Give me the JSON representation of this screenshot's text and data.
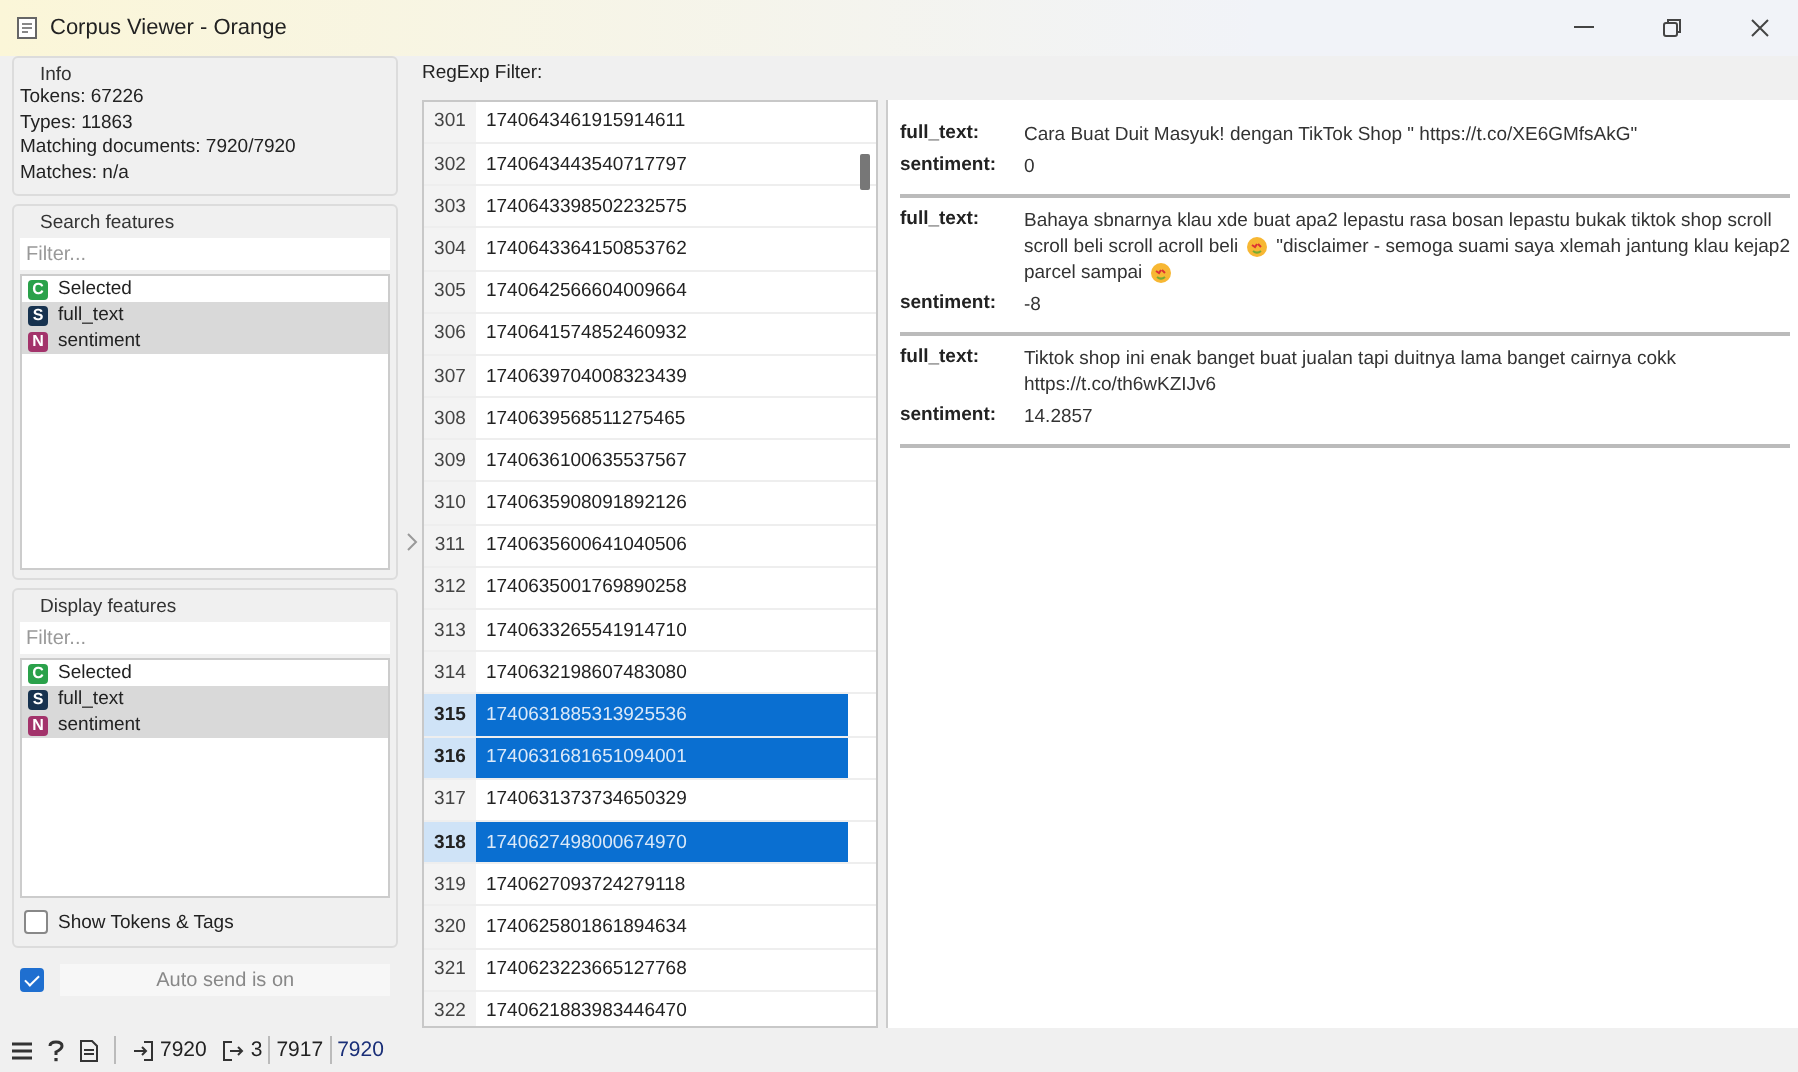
{
  "window": {
    "title": "Corpus Viewer - Orange"
  },
  "info": {
    "title": "Info",
    "lines": [
      "Tokens: 67226",
      "Types: 11863",
      "Matching documents: 7920/7920",
      "Matches: n/a"
    ]
  },
  "search_features": {
    "title": "Search features",
    "filter": {
      "placeholder": "Filter..."
    },
    "items": [
      {
        "badge": "C",
        "label": "Selected",
        "color": "#2aa14a",
        "selected": false
      },
      {
        "badge": "S",
        "label": "full_text",
        "color": "#17324f",
        "selected": true
      },
      {
        "badge": "N",
        "label": "sentiment",
        "color": "#a3336b",
        "selected": true
      }
    ]
  },
  "display_features": {
    "title": "Display features",
    "filter": {
      "placeholder": "Filter..."
    },
    "items": [
      {
        "badge": "C",
        "label": "Selected",
        "color": "#2aa14a",
        "selected": false
      },
      {
        "badge": "S",
        "label": "full_text",
        "color": "#17324f",
        "selected": true
      },
      {
        "badge": "N",
        "label": "sentiment",
        "color": "#a3336b",
        "selected": true
      }
    ]
  },
  "show_tokens": {
    "label": "Show Tokens & Tags",
    "checked": false
  },
  "auto_send": {
    "checked": true,
    "label": "Auto send is on"
  },
  "regexp_filter": {
    "label": "RegExp Filter:"
  },
  "documents": [
    {
      "index": "301",
      "id": "1740643461915914611",
      "selected": false
    },
    {
      "index": "302",
      "id": "1740643443540717797",
      "selected": false
    },
    {
      "index": "303",
      "id": "1740643398502232575",
      "selected": false
    },
    {
      "index": "304",
      "id": "1740643364150853762",
      "selected": false
    },
    {
      "index": "305",
      "id": "1740642566604009664",
      "selected": false
    },
    {
      "index": "306",
      "id": "1740641574852460932",
      "selected": false
    },
    {
      "index": "307",
      "id": "1740639704008323439",
      "selected": false
    },
    {
      "index": "308",
      "id": "1740639568511275465",
      "selected": false
    },
    {
      "index": "309",
      "id": "1740636100635537567",
      "selected": false
    },
    {
      "index": "310",
      "id": "1740635908091892126",
      "selected": false
    },
    {
      "index": "311",
      "id": "1740635600641040506",
      "selected": false
    },
    {
      "index": "312",
      "id": "1740635001769890258",
      "selected": false
    },
    {
      "index": "313",
      "id": "1740633265541914710",
      "selected": false
    },
    {
      "index": "314",
      "id": "1740632198607483080",
      "selected": false
    },
    {
      "index": "315",
      "id": "1740631885313925536",
      "selected": true
    },
    {
      "index": "316",
      "id": "1740631681651094001",
      "selected": true
    },
    {
      "index": "317",
      "id": "1740631373734650329",
      "selected": false
    },
    {
      "index": "318",
      "id": "1740627498000674970",
      "selected": true
    },
    {
      "index": "319",
      "id": "1740627093724279118",
      "selected": false
    },
    {
      "index": "320",
      "id": "1740625801861894634",
      "selected": false
    },
    {
      "index": "321",
      "id": "1740623223665127768",
      "selected": false
    },
    {
      "index": "322",
      "id": "1740621883983446470",
      "selected": false
    }
  ],
  "details": [
    {
      "fields": [
        {
          "key": "full_text:",
          "parts": [
            "Cara Buat Duit Masyuk! dengan TikTok Shop \" https://t.co/XE6GMfsAkG\""
          ]
        },
        {
          "key": "sentiment:",
          "parts": [
            "0"
          ]
        }
      ]
    },
    {
      "fields": [
        {
          "key": "full_text:",
          "lines": [
            [
              {
                "kind": "text",
                "text": "Bahaya sbnarnya klau xde buat apa2 lepastu rasa bosan lepastu bukak tiktok shop scroll"
              }
            ],
            [
              {
                "kind": "text",
                "text": "scroll beli scroll acroll beli"
              },
              {
                "kind": "emoji"
              },
              {
                "kind": "text",
                "text": "\"disclaimer - semoga suami saya xlemah jantung klau kejap2"
              }
            ],
            [
              {
                "kind": "text",
                "text": "parcel sampai"
              },
              {
                "kind": "emoji"
              }
            ]
          ]
        },
        {
          "key": "sentiment:",
          "parts": [
            "-8"
          ]
        }
      ]
    },
    {
      "fields": [
        {
          "key": "full_text:",
          "lines": [
            [
              {
                "kind": "text",
                "text": "Tiktok shop ini enak banget buat jualan tapi duitnya lama banget cairnya cokk"
              }
            ],
            [
              {
                "kind": "text",
                "text": "https://t.co/th6wKZIJv6"
              }
            ]
          ]
        },
        {
          "key": "sentiment:",
          "parts": [
            "14.2857"
          ]
        }
      ]
    }
  ],
  "status_bar": {
    "input_count": "7920",
    "output_counts": [
      "3",
      "7917",
      "7920"
    ]
  }
}
